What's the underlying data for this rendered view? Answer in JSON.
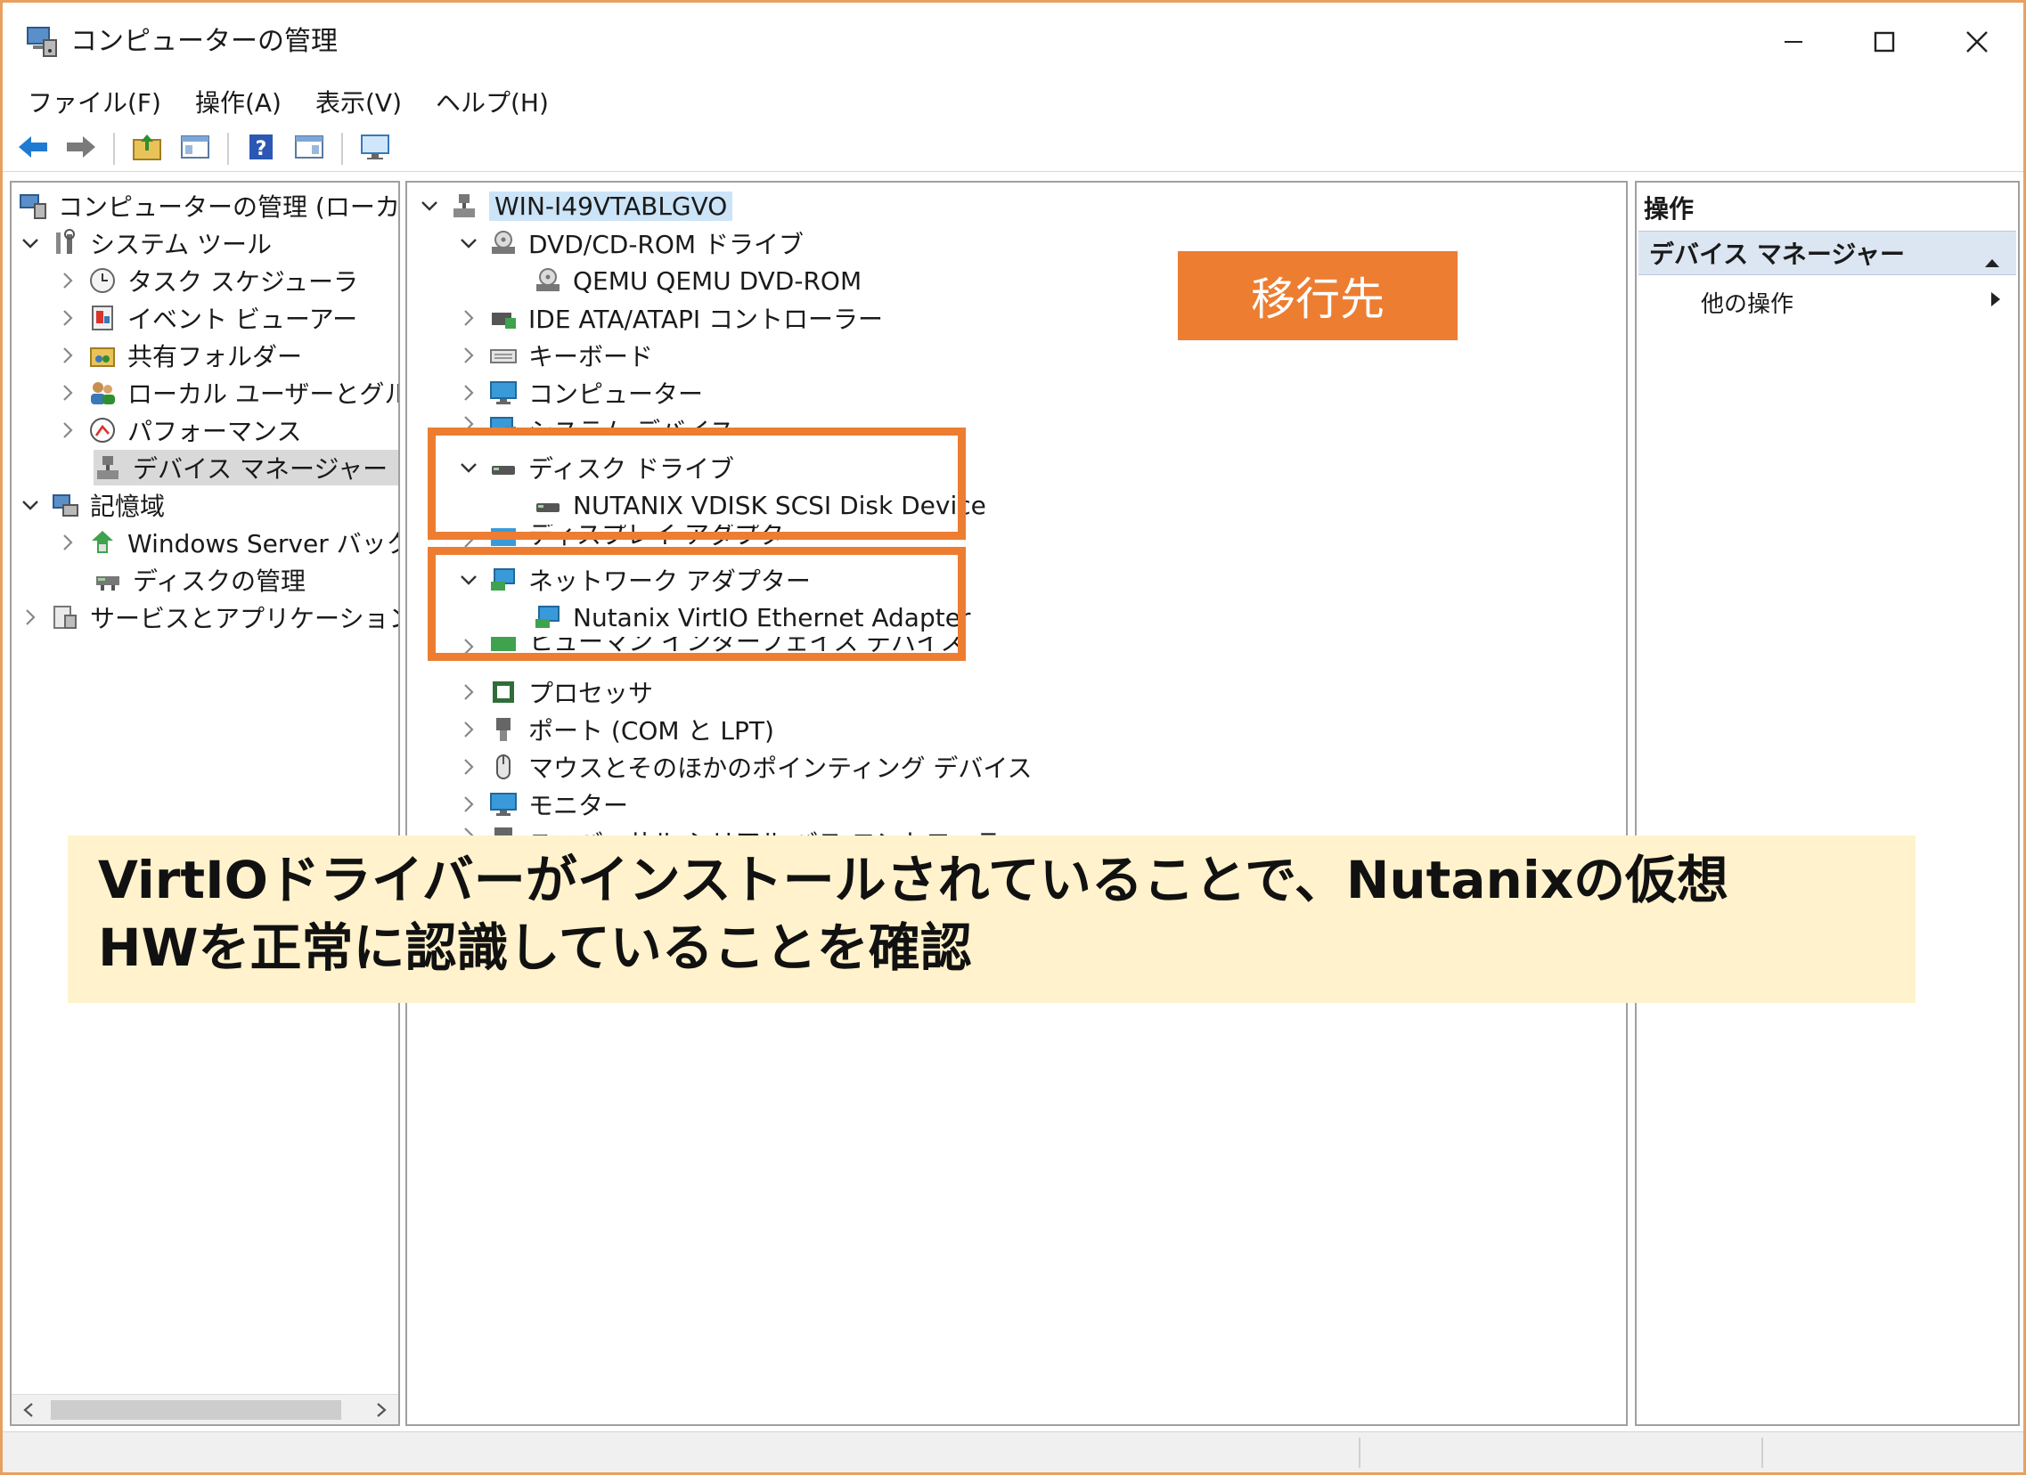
{
  "window": {
    "title": "コンピューターの管理"
  },
  "menu": [
    "ファイル(F)",
    "操作(A)",
    "表示(V)",
    "ヘルプ(H)"
  ],
  "left_tree": [
    {
      "label": "コンピューターの管理 (ローカル)",
      "icon": "computer-management-icon"
    },
    {
      "label": "システム ツール",
      "icon": "tools-icon"
    },
    {
      "label": "タスク スケジューラ",
      "icon": "clock-icon"
    },
    {
      "label": "イベント ビューアー",
      "icon": "event-viewer-icon"
    },
    {
      "label": "共有フォルダー",
      "icon": "shared-folder-icon"
    },
    {
      "label": "ローカル ユーザーとグループ",
      "icon": "users-icon"
    },
    {
      "label": "パフォーマンス",
      "icon": "performance-icon"
    },
    {
      "label": "デバイス マネージャー",
      "icon": "device-manager-icon"
    },
    {
      "label": "記憶域",
      "icon": "storage-icon"
    },
    {
      "label": "Windows Server バックアップ",
      "icon": "backup-icon"
    },
    {
      "label": "ディスクの管理",
      "icon": "disk-management-icon"
    },
    {
      "label": "サービスとアプリケーション",
      "icon": "services-icon"
    }
  ],
  "device_tree": [
    {
      "label": "WIN-I49VTABLGVO",
      "icon": "computer-root-icon"
    },
    {
      "label": "DVD/CD-ROM ドライブ",
      "icon": "dvd-icon"
    },
    {
      "label": "QEMU QEMU DVD-ROM",
      "icon": "dvd-icon"
    },
    {
      "label": "IDE ATA/ATAPI コントローラー",
      "icon": "ide-icon"
    },
    {
      "label": "キーボード",
      "icon": "keyboard-icon"
    },
    {
      "label": "コンピューター",
      "icon": "monitor-icon"
    },
    {
      "label": "システム デバイス",
      "icon": "system-device-icon"
    },
    {
      "label": "ディスク ドライブ",
      "icon": "disk-drive-icon"
    },
    {
      "label": "NUTANIX VDISK SCSI Disk Device",
      "icon": "disk-drive-icon"
    },
    {
      "label": "ディスプレイ アダプター",
      "icon": "display-adapter-icon"
    },
    {
      "label": "ネットワーク アダプター",
      "icon": "network-adapter-icon"
    },
    {
      "label": "Nutanix VirtIO Ethernet Adapter",
      "icon": "network-adapter-icon"
    },
    {
      "label": "ヒューマン インターフェイス デバイス",
      "icon": "hid-icon"
    },
    {
      "label": "プロセッサ",
      "icon": "processor-icon"
    },
    {
      "label": "ポート (COM と LPT)",
      "icon": "port-icon"
    },
    {
      "label": "マウスとそのほかのポインティング デバイス",
      "icon": "mouse-icon"
    },
    {
      "label": "モニター",
      "icon": "monitor-icon"
    },
    {
      "label": "ユニバーサル シリアル バス コントローラー",
      "icon": "usb-icon"
    }
  ],
  "actions": {
    "header": "操作",
    "section": "デバイス マネージャー",
    "item": "他の操作"
  },
  "overlay": {
    "label": "移行先",
    "note_line1": "VirtIOドライバーがインストールされていることで、Nutanixの仮想",
    "note_line2": "HWを正常に認識していることを確認"
  },
  "colors": {
    "accent": "#ed7d31",
    "note_bg": "#fff2cc",
    "selection": "#cce4f7"
  }
}
